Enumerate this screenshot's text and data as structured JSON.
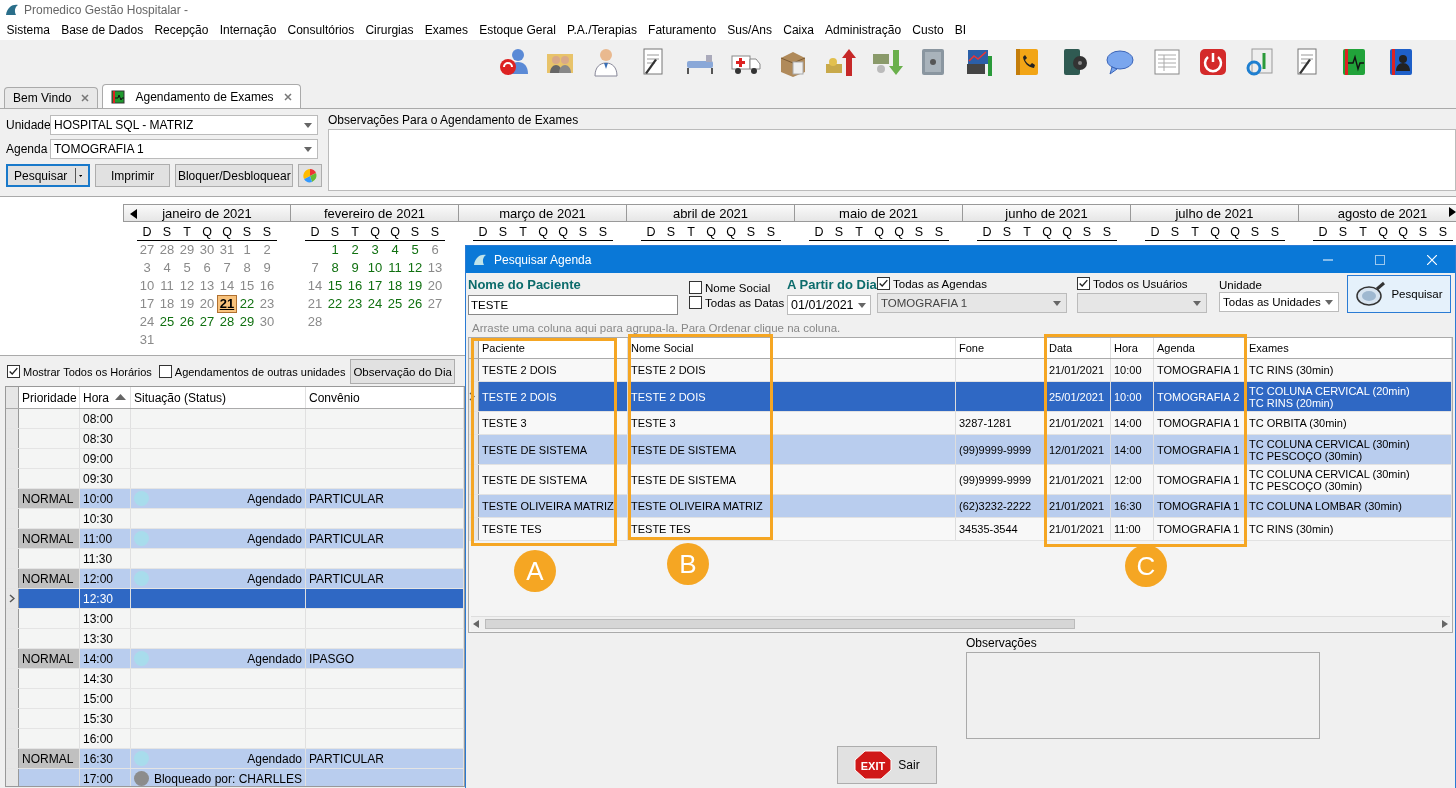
{
  "window": {
    "title": "Promedico Gestão Hospitalar -"
  },
  "menu": [
    "Sistema",
    "Base de Dados",
    "Recepção",
    "Internação",
    "Consultórios",
    "Cirurgias",
    "Exames",
    "Estoque Geral",
    "P.A./Terapias",
    "Faturamento",
    "Sus/Ans",
    "Caixa",
    "Administração",
    "Custo",
    "BI"
  ],
  "tabs": [
    {
      "label": "Bem Vindo",
      "selected": false
    },
    {
      "label": "Agendamento de Exames",
      "selected": true
    }
  ],
  "filters": {
    "unidade_label": "Unidade",
    "unidade": "HOSPITAL SQL - MATRIZ",
    "agenda_label": "Agenda",
    "agenda": "TOMOGRAFIA 1",
    "buttons": [
      {
        "label": "Pesquisar",
        "focused": true
      },
      {
        "label": "Imprimir",
        "focused": false
      },
      {
        "label": "Bloquer/Desbloquear",
        "focused": false
      }
    ]
  },
  "observacoes": {
    "label": "Observações Para o Agendamento de Exames"
  },
  "calendar": {
    "months": [
      {
        "name": "janeiro de 2021",
        "weekdays": [
          "D",
          "S",
          "T",
          "Q",
          "Q",
          "S",
          "S"
        ],
        "weeks": [
          [
            {
              "d": "27",
              "available": false,
              "selected": false
            },
            {
              "d": "28",
              "available": false,
              "selected": false
            },
            {
              "d": "29",
              "available": false,
              "selected": false
            },
            {
              "d": "30",
              "available": false,
              "selected": false
            },
            {
              "d": "31",
              "available": false,
              "selected": false
            },
            {
              "d": "1",
              "available": false,
              "selected": false
            },
            {
              "d": "2",
              "available": false,
              "selected": false
            }
          ],
          [
            {
              "d": "3",
              "available": false,
              "selected": false
            },
            {
              "d": "4",
              "available": false,
              "selected": false
            },
            {
              "d": "5",
              "available": false,
              "selected": false
            },
            {
              "d": "6",
              "available": false,
              "selected": false
            },
            {
              "d": "7",
              "available": false,
              "selected": false
            },
            {
              "d": "8",
              "available": false,
              "selected": false
            },
            {
              "d": "9",
              "available": false,
              "selected": false
            }
          ],
          [
            {
              "d": "10",
              "available": false,
              "selected": false
            },
            {
              "d": "11",
              "available": false,
              "selected": false
            },
            {
              "d": "12",
              "available": false,
              "selected": false
            },
            {
              "d": "13",
              "available": false,
              "selected": false
            },
            {
              "d": "14",
              "available": false,
              "selected": false
            },
            {
              "d": "15",
              "available": false,
              "selected": false
            },
            {
              "d": "16",
              "available": false,
              "selected": false
            }
          ],
          [
            {
              "d": "17",
              "available": false,
              "selected": false
            },
            {
              "d": "18",
              "available": false,
              "selected": false
            },
            {
              "d": "19",
              "available": false,
              "selected": false
            },
            {
              "d": "20",
              "available": false,
              "selected": false
            },
            {
              "d": "21",
              "available": false,
              "selected": true
            },
            {
              "d": "22",
              "available": true,
              "selected": false
            },
            {
              "d": "23",
              "available": false,
              "selected": false
            }
          ],
          [
            {
              "d": "24",
              "available": false,
              "selected": false
            },
            {
              "d": "25",
              "available": true,
              "selected": false
            },
            {
              "d": "26",
              "available": true,
              "selected": false
            },
            {
              "d": "27",
              "available": true,
              "selected": false
            },
            {
              "d": "28",
              "available": true,
              "selected": false
            },
            {
              "d": "29",
              "available": true,
              "selected": false
            },
            {
              "d": "30",
              "available": false,
              "selected": false
            }
          ],
          [
            {
              "d": "31",
              "available": false,
              "selected": false
            }
          ]
        ]
      },
      {
        "name": "fevereiro de 2021",
        "weekdays": [
          "D",
          "S",
          "T",
          "Q",
          "Q",
          "S",
          "S"
        ],
        "weeks": [
          [
            {
              "d": "1",
              "available": true,
              "selected": false
            },
            {
              "d": "2",
              "available": true,
              "selected": false
            },
            {
              "d": "3",
              "available": true,
              "selected": false
            },
            {
              "d": "4",
              "available": true,
              "selected": false
            },
            {
              "d": "5",
              "available": true,
              "selected": false
            },
            {
              "d": "6",
              "available": false,
              "selected": false
            }
          ],
          [
            {
              "d": "7",
              "available": false,
              "selected": false
            },
            {
              "d": "8",
              "available": true,
              "selected": false
            },
            {
              "d": "9",
              "available": true,
              "selected": false
            },
            {
              "d": "10",
              "available": true,
              "selected": false
            },
            {
              "d": "11",
              "available": true,
              "selected": false
            },
            {
              "d": "12",
              "available": true,
              "selected": false
            },
            {
              "d": "13",
              "available": false,
              "selected": false
            }
          ],
          [
            {
              "d": "14",
              "available": false,
              "selected": false
            },
            {
              "d": "15",
              "available": true,
              "selected": false
            },
            {
              "d": "16",
              "available": true,
              "selected": false
            },
            {
              "d": "17",
              "available": true,
              "selected": false
            },
            {
              "d": "18",
              "available": true,
              "selected": false
            },
            {
              "d": "19",
              "available": true,
              "selected": false
            },
            {
              "d": "20",
              "available": false,
              "selected": false
            }
          ],
          [
            {
              "d": "21",
              "available": false,
              "selected": false
            },
            {
              "d": "22",
              "available": true,
              "selected": false
            },
            {
              "d": "23",
              "available": true,
              "selected": false
            },
            {
              "d": "24",
              "available": true,
              "selected": false
            },
            {
              "d": "25",
              "available": true,
              "selected": false
            },
            {
              "d": "26",
              "available": true,
              "selected": false
            },
            {
              "d": "27",
              "available": false,
              "selected": false
            }
          ],
          [
            {
              "d": "28",
              "available": false,
              "selected": false
            }
          ]
        ]
      },
      {
        "name": "março de 2021",
        "weekdays": [
          "D",
          "S",
          "T",
          "Q",
          "Q",
          "S",
          "S"
        ]
      },
      {
        "name": "abril de 2021",
        "weekdays": [
          "D",
          "S",
          "T",
          "Q",
          "Q",
          "S",
          "S"
        ]
      },
      {
        "name": "maio de 2021",
        "weekdays": [
          "D",
          "S",
          "T",
          "Q",
          "Q",
          "S",
          "S"
        ]
      },
      {
        "name": "junho de 2021",
        "weekdays": [
          "D",
          "S",
          "T",
          "Q",
          "Q",
          "S",
          "S"
        ]
      },
      {
        "name": "julho de 2021",
        "weekdays": [
          "D",
          "S",
          "T",
          "Q",
          "Q",
          "S",
          "S"
        ]
      },
      {
        "name": "agosto de 2021",
        "weekdays": [
          "D",
          "S",
          "T",
          "Q",
          "Q",
          "S",
          "S"
        ]
      }
    ]
  },
  "schedule": {
    "options": [
      {
        "label": "Mostrar Todos os Horários",
        "checked": true
      },
      {
        "label": "Agendamentos de outras unidades",
        "checked": false
      }
    ],
    "day_note_button": "Observação do Dia",
    "columns": [
      {
        "label": "Prioridade",
        "sorted": false
      },
      {
        "label": "Hora",
        "sorted": true
      },
      {
        "label": "Situação (Status)",
        "sorted": false
      },
      {
        "label": "Convênio",
        "sorted": false
      }
    ],
    "rows": [
      {
        "hora": "08:00",
        "occupied": false,
        "selected": false
      },
      {
        "hora": "08:30",
        "occupied": false,
        "selected": false
      },
      {
        "hora": "09:00",
        "occupied": false,
        "selected": false
      },
      {
        "hora": "09:30",
        "occupied": false,
        "selected": false
      },
      {
        "prioridade": "NORMAL",
        "hora": "10:00",
        "color": "#a8dcec",
        "status": "Agendado",
        "convenio": "PARTICULAR",
        "occupied": true,
        "selected": false
      },
      {
        "hora": "10:30",
        "occupied": false,
        "selected": false
      },
      {
        "prioridade": "NORMAL",
        "hora": "11:00",
        "color": "#a8dcec",
        "status": "Agendado",
        "convenio": "PARTICULAR",
        "occupied": true,
        "selected": false
      },
      {
        "hora": "11:30",
        "occupied": false,
        "selected": false
      },
      {
        "prioridade": "NORMAL",
        "hora": "12:00",
        "color": "#a8dcec",
        "status": "Agendado",
        "convenio": "PARTICULAR",
        "occupied": true,
        "selected": false
      },
      {
        "hora": "12:30",
        "occupied": false,
        "selected": true
      },
      {
        "hora": "13:00",
        "occupied": false,
        "selected": false
      },
      {
        "hora": "13:30",
        "occupied": false,
        "selected": false
      },
      {
        "prioridade": "NORMAL",
        "hora": "14:00",
        "color": "#a8dcec",
        "status": "Agendado",
        "convenio": "IPASGO",
        "occupied": true,
        "selected": false
      },
      {
        "hora": "14:30",
        "occupied": false,
        "selected": false
      },
      {
        "hora": "15:00",
        "occupied": false,
        "selected": false
      },
      {
        "hora": "15:30",
        "occupied": false,
        "selected": false
      },
      {
        "hora": "16:00",
        "occupied": false,
        "selected": false
      },
      {
        "prioridade": "NORMAL",
        "hora": "16:30",
        "color": "#a8dcec",
        "status": "Agendado",
        "convenio": "PARTICULAR",
        "occupied": true,
        "selected": false
      },
      {
        "hora": "17:00",
        "color": "#8c8c8c",
        "status": "Bloqueado por: CHARLLES",
        "occupied": true,
        "selected": false
      }
    ]
  },
  "dialog": {
    "title": "Pesquisar Agenda",
    "patient_label": "Nome do Paciente",
    "patient": "TESTE",
    "checks": [
      {
        "label": "Nome Social",
        "checked": false
      },
      {
        "label": "Todas as Datas",
        "checked": false
      }
    ],
    "date_label": "A Partir do Dia",
    "date": "01/01/2021",
    "all_agendas": {
      "label": "Todas as Agendas",
      "checked": true
    },
    "agenda_select": {
      "value": "TOMOGRAFIA 1",
      "disabled": true
    },
    "all_users": {
      "label": "Todos os Usuários",
      "checked": true
    },
    "users_select": {
      "disabled": true
    },
    "unit_label": "Unidade",
    "unit": "Todas as Unidades",
    "search_button": "Pesquisar",
    "group_hint": "Arraste uma coluna aqui para agrupa-la. Para Ordenar clique na coluna.",
    "columns": [
      "Paciente",
      "Nome Social",
      "Fone",
      "Data",
      "Hora",
      "Agenda",
      "Exames"
    ],
    "rows": [
      {
        "paciente": "TESTE 2 DOIS",
        "nome_social": "TESTE 2 DOIS",
        "data": "21/01/2021",
        "hora": "10:00",
        "agenda": "TOMOGRAFIA 1",
        "exames": [
          "TC RINS (30min)"
        ],
        "selected": false
      },
      {
        "paciente": "TESTE 2 DOIS",
        "nome_social": "TESTE 2 DOIS",
        "data": "25/01/2021",
        "hora": "10:00",
        "agenda": "TOMOGRAFIA 2",
        "exames": [
          "TC COLUNA CERVICAL (20min)",
          "TC RINS (20min)"
        ],
        "selected": true
      },
      {
        "paciente": "TESTE 3",
        "nome_social": "TESTE 3",
        "fone": "3287-1281",
        "data": "21/01/2021",
        "hora": "14:00",
        "agenda": "TOMOGRAFIA 1",
        "exames": [
          "TC ORBITA (30min)"
        ],
        "selected": false
      },
      {
        "paciente": "TESTE DE SISTEMA",
        "nome_social": "TESTE DE SISTEMA",
        "fone": "(99)9999-9999",
        "data": "12/01/2021",
        "hora": "14:00",
        "agenda": "TOMOGRAFIA 1",
        "exames": [
          "TC COLUNA CERVICAL (30min)",
          "TC PESCOÇO (30min)"
        ],
        "selected": false
      },
      {
        "paciente": "TESTE DE SISTEMA",
        "nome_social": "TESTE DE SISTEMA",
        "fone": "(99)9999-9999",
        "data": "21/01/2021",
        "hora": "12:00",
        "agenda": "TOMOGRAFIA 1",
        "exames": [
          "TC COLUNA CERVICAL (30min)",
          "TC PESCOÇO (30min)"
        ],
        "selected": false
      },
      {
        "paciente": "TESTE OLIVEIRA MATRIZ",
        "nome_social": "TESTE OLIVEIRA MATRIZ",
        "fone": "(62)3232-2222",
        "data": "21/01/2021",
        "hora": "16:30",
        "agenda": "TOMOGRAFIA 1",
        "exames": [
          "TC COLUNA LOMBAR (30min)"
        ],
        "selected": false
      },
      {
        "paciente": "TESTE TES",
        "nome_social": "TESTE TES",
        "fone": "34535-3544",
        "data": "21/01/2021",
        "hora": "11:00",
        "agenda": "TOMOGRAFIA 1",
        "exames": [
          "TC RINS (30min)"
        ],
        "selected": false
      }
    ],
    "obs_label": "Observações",
    "exit_sign": "EXIT",
    "exit_button": "Sair",
    "annotations": [
      "A",
      "B",
      "C"
    ]
  }
}
